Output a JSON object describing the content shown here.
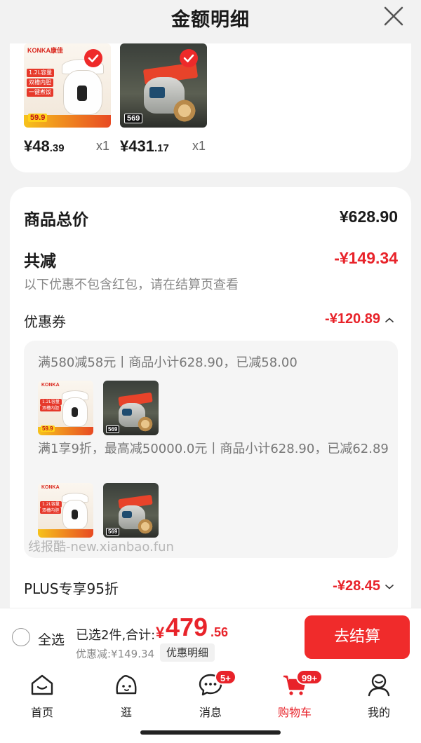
{
  "header": {
    "title": "金额明细"
  },
  "products": [
    {
      "brand": "KONKA康佳",
      "tag_lines": [
        "1.2L容量",
        "双槽内胆",
        "一键煮饭"
      ],
      "thumb_price": "59.9",
      "price_symbol": "¥",
      "price_int": "48",
      "price_cents": ".39",
      "qty": "x1"
    },
    {
      "brand": "",
      "tag_lines": [],
      "thumb_price": "569",
      "price_symbol": "¥",
      "price_int": "431",
      "price_cents": ".17",
      "qty": "x1"
    }
  ],
  "summary": {
    "total_label": "商品总价",
    "total_value": "¥628.90",
    "reduce_label": "共减",
    "reduce_value": "-¥149.34",
    "note": "以下优惠不包含红包，请在结算页查看",
    "coupon_label": "优惠券",
    "coupon_value": "-¥120.89",
    "coupon_details": [
      "满580减58元丨商品小计628.90，已减58.00",
      "满1享9折，最高减50000.0元丨商品小计628.90，已减62.89"
    ],
    "plus_label": "PLUS专享95折",
    "plus_value": "-¥28.45"
  },
  "watermark": "线报酷-new.xianbao.fun",
  "action_bar": {
    "select_all": "全选",
    "selected_summary": "已选2件,合计:",
    "total_symbol": "¥",
    "total_int": "479",
    "total_cents": ".56",
    "discount_text": "优惠减:¥149.34",
    "detail_button": "优惠明细",
    "checkout_button": "去结算"
  },
  "tabs": [
    {
      "label": "首页",
      "icon": "home-icon"
    },
    {
      "label": "逛",
      "icon": "browse-face-icon"
    },
    {
      "label": "消息",
      "icon": "message-icon",
      "badge": "5+"
    },
    {
      "label": "购物车",
      "icon": "cart-icon",
      "badge": "99+",
      "active": true
    },
    {
      "label": "我的",
      "icon": "profile-icon"
    }
  ],
  "colors": {
    "accent": "#e8232a",
    "checkout": "#f02b2b",
    "background": "#f2f2f2"
  }
}
